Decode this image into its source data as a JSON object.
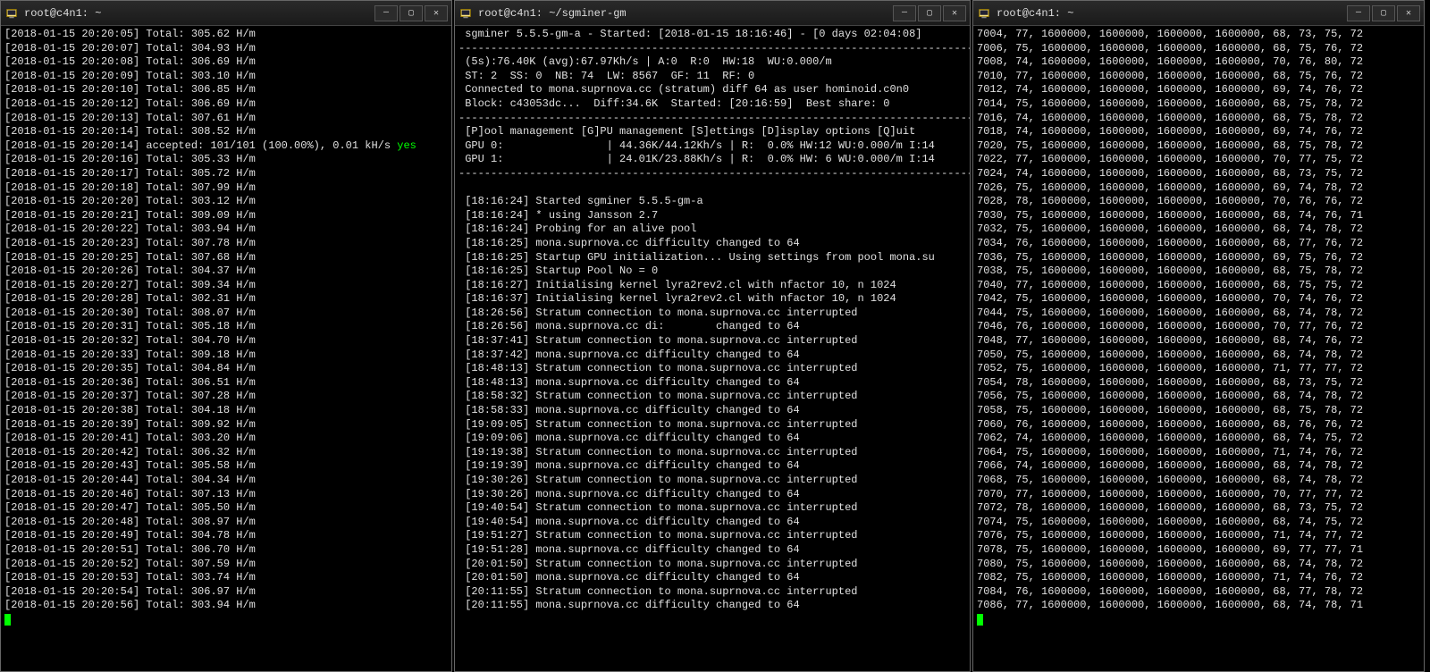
{
  "windows": {
    "left": {
      "title": "root@c4n1: ~",
      "lines": [
        "[2018-01-15 20:20:05] Total: 305.62 H/m",
        "[2018-01-15 20:20:07] Total: 304.93 H/m",
        "[2018-01-15 20:20:08] Total: 306.69 H/m",
        "[2018-01-15 20:20:09] Total: 303.10 H/m",
        "[2018-01-15 20:20:10] Total: 306.85 H/m",
        "[2018-01-15 20:20:12] Total: 306.69 H/m",
        "[2018-01-15 20:20:13] Total: 307.61 H/m",
        "[2018-01-15 20:20:14] Total: 308.52 H/m"
      ],
      "accepted_line_pre": "[2018-01-15 20:20:14] accepted: 101/101 (100.00%), 0.01 kH/s ",
      "accepted_yes": "yes",
      "lines_after": [
        "[2018-01-15 20:20:16] Total: 305.33 H/m",
        "[2018-01-15 20:20:17] Total: 305.72 H/m",
        "[2018-01-15 20:20:18] Total: 307.99 H/m",
        "[2018-01-15 20:20:20] Total: 303.12 H/m",
        "[2018-01-15 20:20:21] Total: 309.09 H/m",
        "[2018-01-15 20:20:22] Total: 303.94 H/m",
        "[2018-01-15 20:20:23] Total: 307.78 H/m",
        "[2018-01-15 20:20:25] Total: 307.68 H/m",
        "[2018-01-15 20:20:26] Total: 304.37 H/m",
        "[2018-01-15 20:20:27] Total: 309.34 H/m",
        "[2018-01-15 20:20:28] Total: 302.31 H/m",
        "[2018-01-15 20:20:30] Total: 308.07 H/m",
        "[2018-01-15 20:20:31] Total: 305.18 H/m",
        "[2018-01-15 20:20:32] Total: 304.70 H/m",
        "[2018-01-15 20:20:33] Total: 309.18 H/m",
        "[2018-01-15 20:20:35] Total: 304.84 H/m",
        "[2018-01-15 20:20:36] Total: 306.51 H/m",
        "[2018-01-15 20:20:37] Total: 307.28 H/m",
        "[2018-01-15 20:20:38] Total: 304.18 H/m",
        "[2018-01-15 20:20:39] Total: 309.92 H/m",
        "[2018-01-15 20:20:41] Total: 303.20 H/m",
        "[2018-01-15 20:20:42] Total: 306.32 H/m",
        "[2018-01-15 20:20:43] Total: 305.58 H/m",
        "[2018-01-15 20:20:44] Total: 304.34 H/m",
        "[2018-01-15 20:20:46] Total: 307.13 H/m",
        "[2018-01-15 20:20:47] Total: 305.50 H/m",
        "[2018-01-15 20:20:48] Total: 308.97 H/m",
        "[2018-01-15 20:20:49] Total: 304.78 H/m",
        "[2018-01-15 20:20:51] Total: 306.70 H/m",
        "[2018-01-15 20:20:52] Total: 307.59 H/m",
        "[2018-01-15 20:20:53] Total: 303.74 H/m",
        "[2018-01-15 20:20:54] Total: 306.97 H/m",
        "[2018-01-15 20:20:56] Total: 303.94 H/m"
      ]
    },
    "middle": {
      "title": "root@c4n1: ~/sgminer-gm",
      "header": [
        " sgminer 5.5.5-gm-a - Started: [2018-01-15 18:16:46] - [0 days 02:04:08]",
        "--------------------------------------------------------------------------------",
        " (5s):76.40K (avg):67.97Kh/s | A:0  R:0  HW:18  WU:0.000/m",
        " ST: 2  SS: 0  NB: 74  LW: 8567  GF: 11  RF: 0",
        " Connected to mona.suprnova.cc (stratum) diff 64 as user hominoid.c0n0",
        " Block: c43053dc...  Diff:34.6K  Started: [20:16:59]  Best share: 0",
        "--------------------------------------------------------------------------------",
        " [P]ool management [G]PU management [S]ettings [D]isplay options [Q]uit",
        " GPU 0:                | 44.36K/44.12Kh/s | R:  0.0% HW:12 WU:0.000/m I:14",
        " GPU 1:                | 24.01K/23.88Kh/s | R:  0.0% HW: 6 WU:0.000/m I:14",
        "--------------------------------------------------------------------------------"
      ],
      "log": [
        " [18:16:24] Started sgminer 5.5.5-gm-a",
        " [18:16:24] * using Jansson 2.7",
        " [18:16:24] Probing for an alive pool",
        " [18:16:25] mona.suprnova.cc difficulty changed to 64",
        " [18:16:25] Startup GPU initialization... Using settings from pool mona.su",
        " [18:16:25] Startup Pool No = 0",
        " [18:16:27] Initialising kernel lyra2rev2.cl with nfactor 10, n 1024",
        " [18:16:37] Initialising kernel lyra2rev2.cl with nfactor 10, n 1024",
        " [18:26:56] Stratum connection to mona.suprnova.cc interrupted",
        " [18:26:56] mona.suprnova.cc di:        changed to 64",
        " [18:37:41] Stratum connection to mona.suprnova.cc interrupted",
        " [18:37:42] mona.suprnova.cc difficulty changed to 64",
        " [18:48:13] Stratum connection to mona.suprnova.cc interrupted",
        " [18:48:13] mona.suprnova.cc difficulty changed to 64",
        " [18:58:32] Stratum connection to mona.suprnova.cc interrupted",
        " [18:58:33] mona.suprnova.cc difficulty changed to 64",
        " [19:09:05] Stratum connection to mona.suprnova.cc interrupted",
        " [19:09:06] mona.suprnova.cc difficulty changed to 64",
        " [19:19:38] Stratum connection to mona.suprnova.cc interrupted",
        " [19:19:39] mona.suprnova.cc difficulty changed to 64",
        " [19:30:26] Stratum connection to mona.suprnova.cc interrupted",
        " [19:30:26] mona.suprnova.cc difficulty changed to 64",
        " [19:40:54] Stratum connection to mona.suprnova.cc interrupted",
        " [19:40:54] mona.suprnova.cc difficulty changed to 64",
        " [19:51:27] Stratum connection to mona.suprnova.cc interrupted",
        " [19:51:28] mona.suprnova.cc difficulty changed to 64",
        " [20:01:50] Stratum connection to mona.suprnova.cc interrupted",
        " [20:01:50] mona.suprnova.cc difficulty changed to 64",
        " [20:11:55] Stratum connection to mona.suprnova.cc interrupted",
        " [20:11:55] mona.suprnova.cc difficulty changed to 64"
      ]
    },
    "right": {
      "title": "root@c4n1: ~",
      "rows": [
        "7004, 77, 1600000, 1600000, 1600000, 1600000, 68, 73, 75, 72",
        "7006, 75, 1600000, 1600000, 1600000, 1600000, 68, 75, 76, 72",
        "7008, 74, 1600000, 1600000, 1600000, 1600000, 70, 76, 80, 72",
        "7010, 77, 1600000, 1600000, 1600000, 1600000, 68, 75, 76, 72",
        "7012, 74, 1600000, 1600000, 1600000, 1600000, 69, 74, 76, 72",
        "7014, 75, 1600000, 1600000, 1600000, 1600000, 68, 75, 78, 72",
        "7016, 74, 1600000, 1600000, 1600000, 1600000, 68, 75, 78, 72",
        "7018, 74, 1600000, 1600000, 1600000, 1600000, 69, 74, 76, 72",
        "7020, 75, 1600000, 1600000, 1600000, 1600000, 68, 75, 78, 72",
        "7022, 77, 1600000, 1600000, 1600000, 1600000, 70, 77, 75, 72",
        "7024, 74, 1600000, 1600000, 1600000, 1600000, 68, 73, 75, 72",
        "7026, 75, 1600000, 1600000, 1600000, 1600000, 69, 74, 78, 72",
        "7028, 78, 1600000, 1600000, 1600000, 1600000, 70, 76, 76, 72",
        "7030, 75, 1600000, 1600000, 1600000, 1600000, 68, 74, 76, 71",
        "7032, 75, 1600000, 1600000, 1600000, 1600000, 68, 74, 78, 72",
        "7034, 76, 1600000, 1600000, 1600000, 1600000, 68, 77, 76, 72",
        "7036, 75, 1600000, 1600000, 1600000, 1600000, 69, 75, 76, 72",
        "7038, 75, 1600000, 1600000, 1600000, 1600000, 68, 75, 78, 72",
        "7040, 77, 1600000, 1600000, 1600000, 1600000, 68, 75, 75, 72",
        "7042, 75, 1600000, 1600000, 1600000, 1600000, 70, 74, 76, 72",
        "7044, 75, 1600000, 1600000, 1600000, 1600000, 68, 74, 78, 72",
        "7046, 76, 1600000, 1600000, 1600000, 1600000, 70, 77, 76, 72",
        "7048, 77, 1600000, 1600000, 1600000, 1600000, 68, 74, 76, 72",
        "7050, 75, 1600000, 1600000, 1600000, 1600000, 68, 74, 78, 72",
        "7052, 75, 1600000, 1600000, 1600000, 1600000, 71, 77, 77, 72",
        "7054, 78, 1600000, 1600000, 1600000, 1600000, 68, 73, 75, 72",
        "7056, 75, 1600000, 1600000, 1600000, 1600000, 68, 74, 78, 72",
        "7058, 75, 1600000, 1600000, 1600000, 1600000, 68, 75, 78, 72",
        "7060, 76, 1600000, 1600000, 1600000, 1600000, 68, 76, 76, 72",
        "7062, 74, 1600000, 1600000, 1600000, 1600000, 68, 74, 75, 72",
        "7064, 75, 1600000, 1600000, 1600000, 1600000, 71, 74, 76, 72",
        "7066, 74, 1600000, 1600000, 1600000, 1600000, 68, 74, 78, 72",
        "7068, 75, 1600000, 1600000, 1600000, 1600000, 68, 74, 78, 72",
        "7070, 77, 1600000, 1600000, 1600000, 1600000, 70, 77, 77, 72",
        "7072, 78, 1600000, 1600000, 1600000, 1600000, 68, 73, 75, 72",
        "7074, 75, 1600000, 1600000, 1600000, 1600000, 68, 74, 75, 72",
        "7076, 75, 1600000, 1600000, 1600000, 1600000, 71, 74, 77, 72",
        "7078, 75, 1600000, 1600000, 1600000, 1600000, 69, 77, 77, 71",
        "7080, 75, 1600000, 1600000, 1600000, 1600000, 68, 74, 78, 72",
        "7082, 75, 1600000, 1600000, 1600000, 1600000, 71, 74, 76, 72",
        "7084, 76, 1600000, 1600000, 1600000, 1600000, 68, 77, 78, 72",
        "7086, 77, 1600000, 1600000, 1600000, 1600000, 68, 74, 78, 71"
      ]
    }
  },
  "buttons": {
    "min": "—",
    "max": "▢",
    "close": "✕"
  }
}
